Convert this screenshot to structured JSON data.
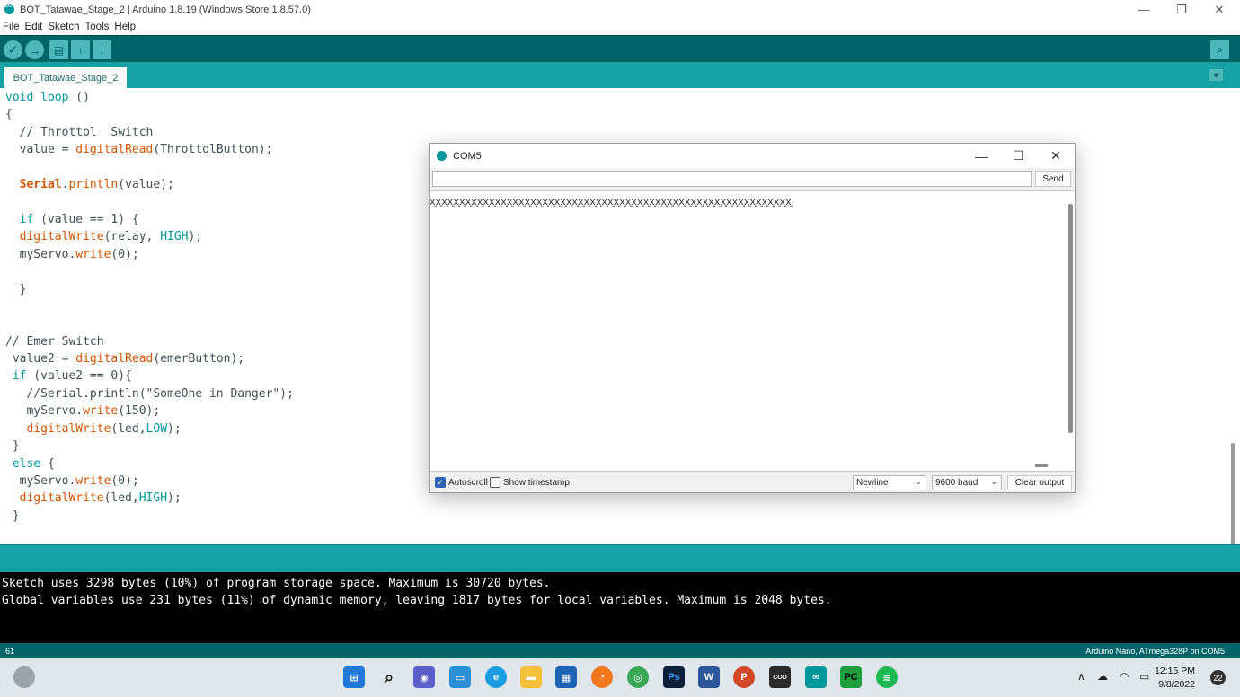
{
  "window": {
    "title": "BOT_Tatawae_Stage_2 | Arduino 1.8.19 (Windows Store 1.8.57.0)",
    "minimize": "—",
    "maximize": "❐",
    "close": "✕"
  },
  "menu": [
    "File",
    "Edit",
    "Sketch",
    "Tools",
    "Help"
  ],
  "toolbar": {
    "verify_icon": "✓",
    "upload_icon": "→",
    "new_icon": "▤",
    "open_icon": "↑",
    "save_icon": "↓",
    "serial_monitor_icon": "⌕"
  },
  "tab": {
    "label": "BOT_Tatawae_Stage_2",
    "menu_icon": "▼"
  },
  "code": [
    "void loop ()",
    "{",
    "  // Throttol  Switch",
    "  value = digitalRead(ThrottolButton);",
    "",
    "  Serial.println(value);",
    "",
    "  if (value == 1) {",
    "  digitalWrite(relay, HIGH);",
    "  myServo.write(0);",
    "",
    "  }",
    "",
    "",
    "// Emer Switch",
    " value2 = digitalRead(emerButton);",
    " if (value2 == 0){",
    "   //Serial.println(\"SomeOne in Danger\");",
    "   myServo.write(150);",
    "   digitalWrite(led,LOW);",
    " }",
    " else {",
    "  myServo.write(0);",
    "  digitalWrite(led,HIGH);",
    " }"
  ],
  "console": {
    "lines": [
      "Sketch uses 3298 bytes (10%) of program storage space. Maximum is 30720 bytes.",
      "Global variables use 231 bytes (11%) of dynamic memory, leaving 1817 bytes for local variables. Maximum is 2048 bytes."
    ]
  },
  "status": {
    "line_number": "61",
    "board": "Arduino Nano, ATmega328P on COM5"
  },
  "serial_monitor": {
    "title": "COM5",
    "input_value": "",
    "send_label": "Send",
    "output": "x͈x͈x͈x͈x͈x͈x͈x͈x͈x͈x͈x͈x͈x͈x͈x͈x͈x͈x͈x͈x͈x͈x͈x͈x͈x͈x͈x͈x͈x͈x͈x͈x͈x͈x͈x͈x͈x͈x͈x͈x͈x͈x͈x͈x͈x͈x͈x͈x͈x͈x͈x͈x͈x͈x͈x͈x͈x͈x͈x͈x͈",
    "autoscroll_label": "Autoscroll",
    "autoscroll_checked": true,
    "timestamp_label": "Show timestamp",
    "timestamp_checked": false,
    "line_ending": "Newline",
    "baud": "9600 baud",
    "clear_label": "Clear output"
  },
  "taskbar": {
    "time": "12:15 PM",
    "date": "9/8/2022",
    "notifications": "22",
    "apps": [
      "start",
      "search",
      "chat",
      "desktop",
      "edge",
      "explorer",
      "store",
      "firefox",
      "chrome",
      "photoshop",
      "word",
      "powerpoint",
      "cod",
      "arduino",
      "pycharm",
      "spotify"
    ]
  },
  "colors": {
    "toolbar": "#006468",
    "tabstrip": "#17a1a5",
    "keyword": "#00979c",
    "function": "#d35400"
  }
}
